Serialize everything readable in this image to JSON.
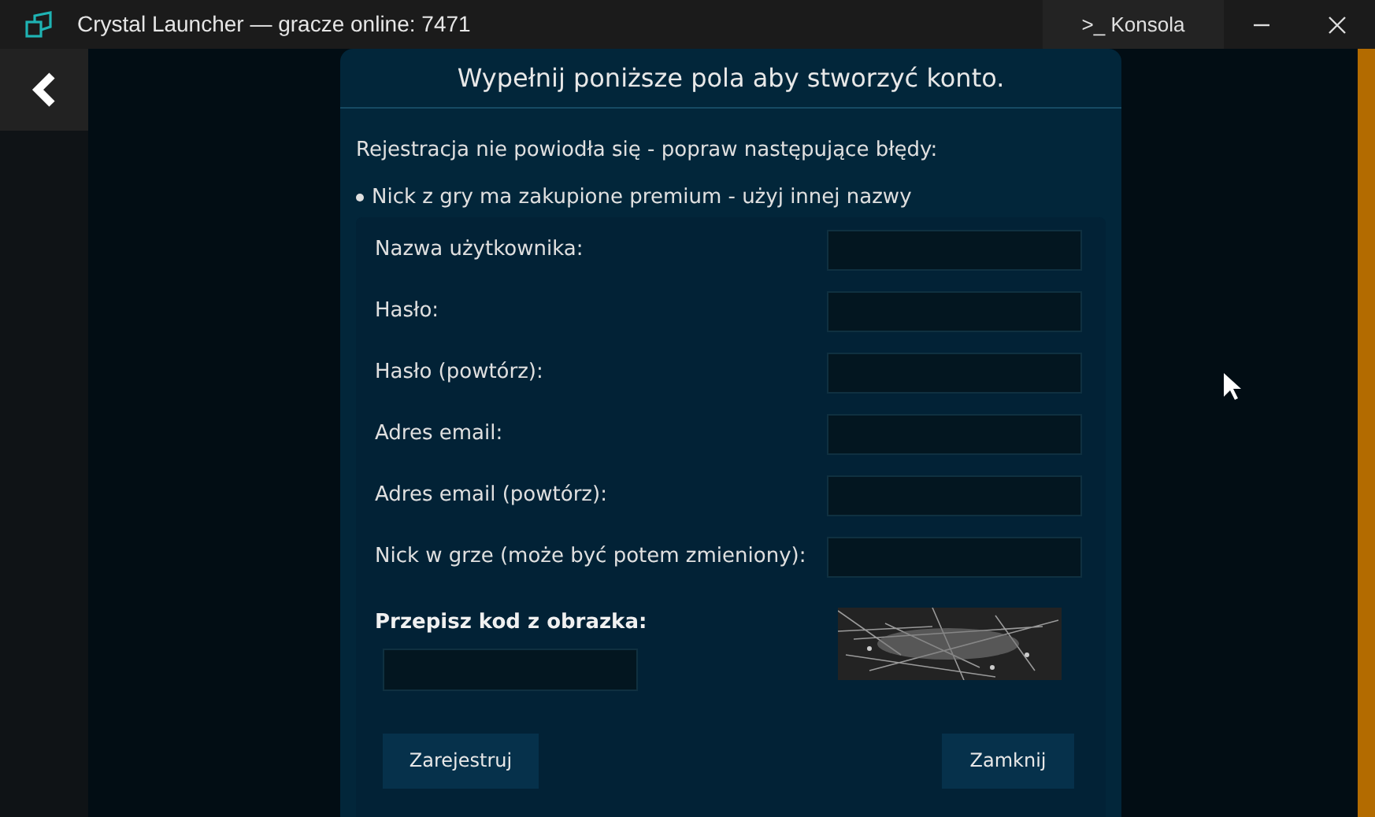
{
  "window": {
    "title": "Crystal Launcher — gracze online: 7471",
    "console_button": ">_ Konsola"
  },
  "dialog": {
    "title": "Wypełnij poniższe pola aby stworzyć konto.",
    "error_heading": "Rejestracja nie powiodła się - popraw następujące błędy:",
    "errors": [
      "Nick z gry ma zakupione premium - użyj innej nazwy"
    ],
    "fields": [
      {
        "label": "Nazwa użytkownika:"
      },
      {
        "label": "Hasło:"
      },
      {
        "label": "Hasło (powtórz):"
      },
      {
        "label": "Adres email:"
      },
      {
        "label": "Adres email (powtórz):"
      },
      {
        "label": "Nick w grze (może być potem zmieniony):"
      }
    ],
    "captcha": {
      "label": "Przepisz kod z obrazka:"
    },
    "buttons": [
      "Zarejestruj",
      "Zamknij"
    ]
  }
}
